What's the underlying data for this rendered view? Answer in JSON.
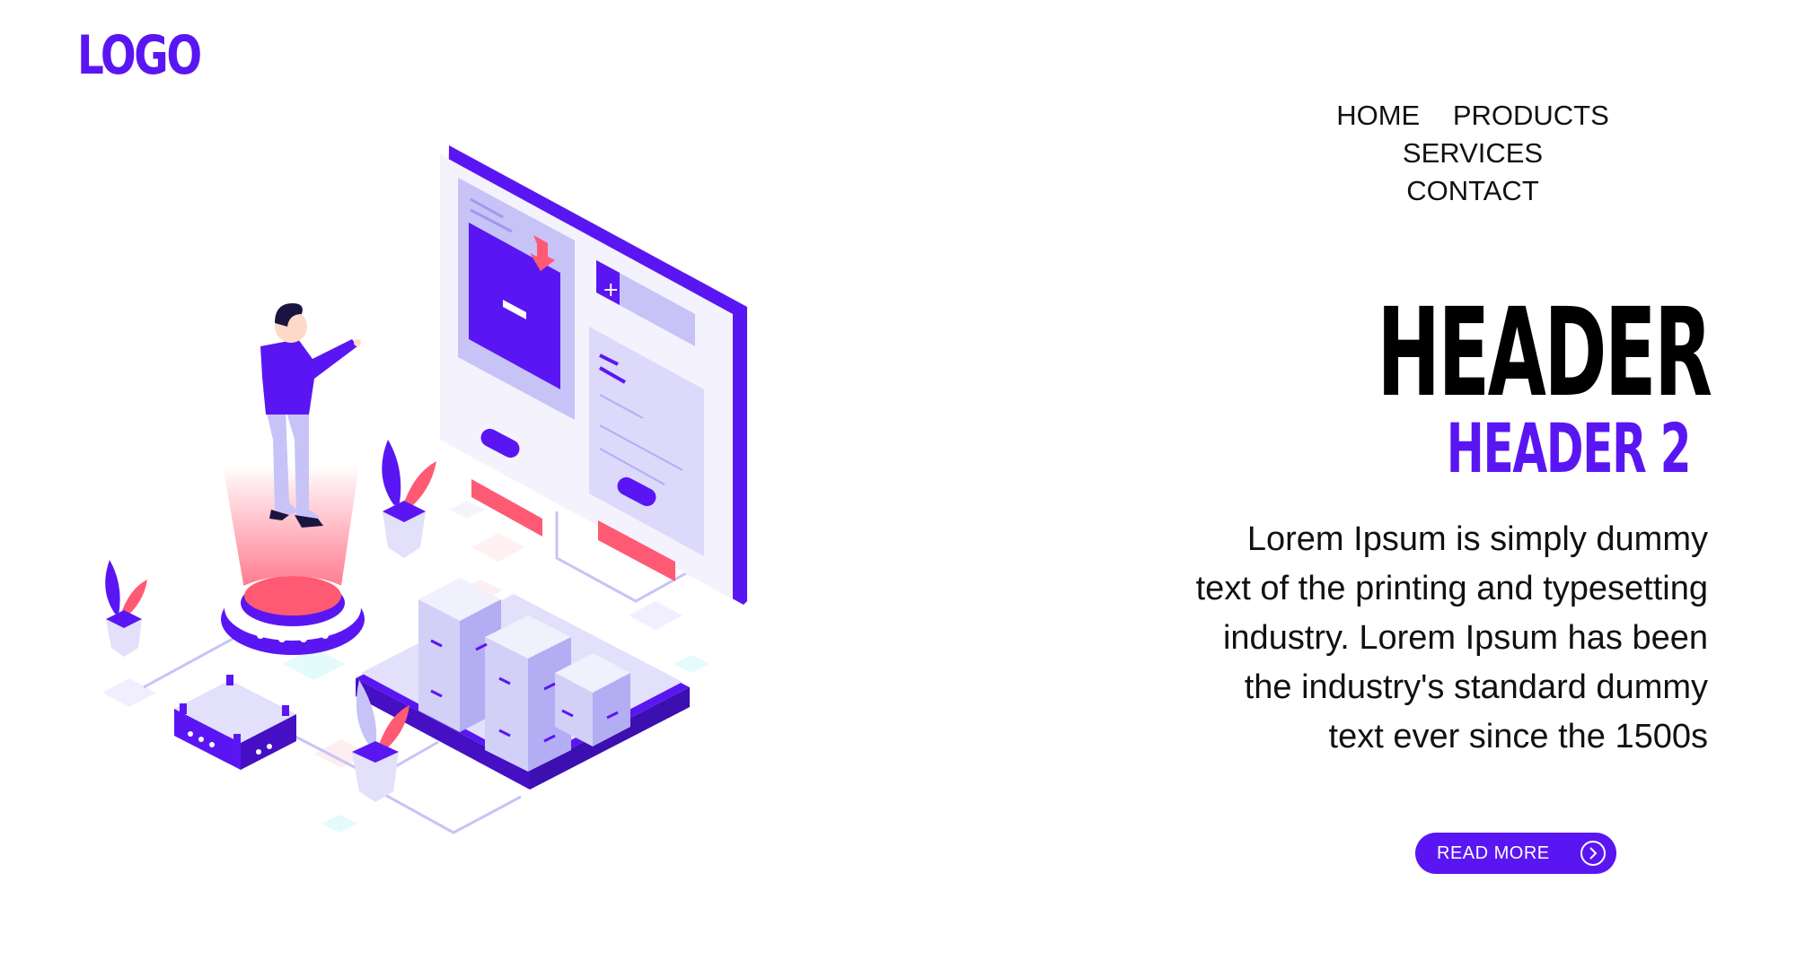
{
  "logo": {
    "text": "LOGO"
  },
  "nav": {
    "items": [
      {
        "label": "HOME"
      },
      {
        "label": "PRODUCTS"
      },
      {
        "label": "SERVICES"
      },
      {
        "label": "CONTACT"
      }
    ]
  },
  "hero": {
    "title": "HEADER",
    "subtitle": "HEADER 2",
    "body": "Lorem Ipsum is simply dummy text of the printing and typesetting industry. Lorem Ipsum has been the industry's standard dummy text ever since the 1500s",
    "cta_label": "READ MORE",
    "cta_icon": "chevron-right-circle-icon"
  },
  "colors": {
    "accent": "#5a16f2",
    "accent_light": "#c7c3f7",
    "coral": "#ff5a73",
    "text": "#111111",
    "background": "#ffffff"
  },
  "illustration": {
    "icon": "isometric-dashboard-illustration"
  }
}
